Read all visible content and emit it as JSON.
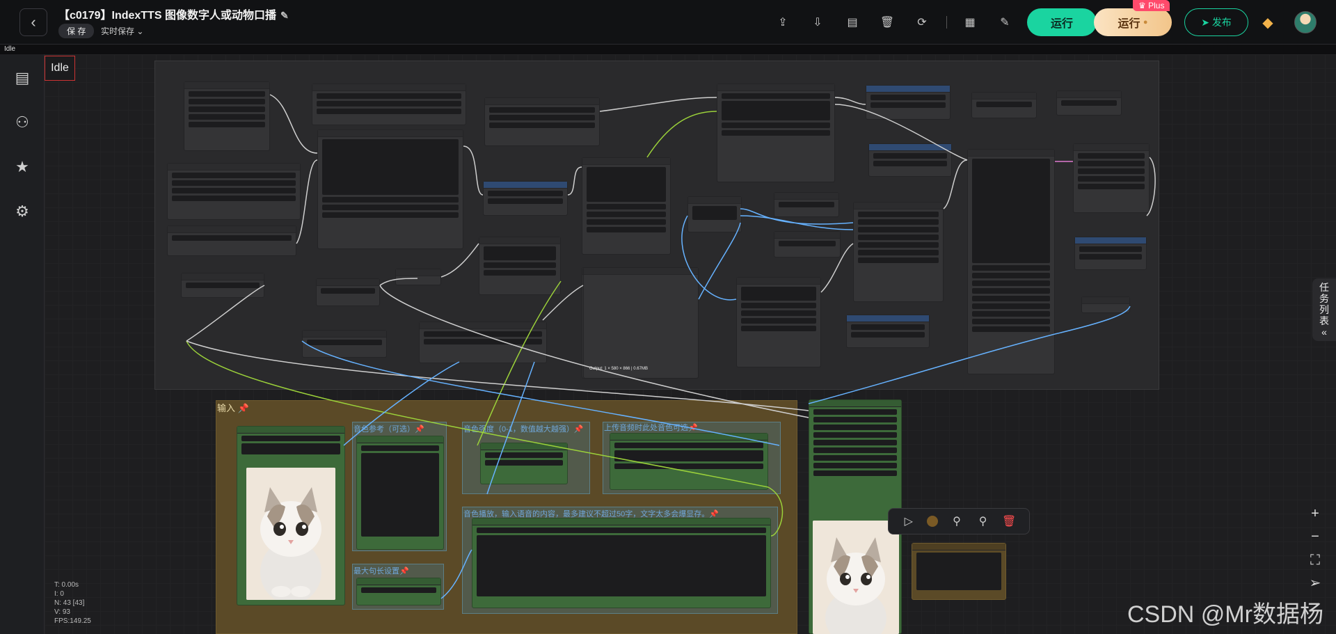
{
  "app": {
    "title": "【c0179】IndexTTS 图像数字人或动物口播",
    "save_label": "保 存",
    "autosave_label": "实时保存",
    "status_strip": "Idle",
    "status_box": "Idle"
  },
  "toolbar": {
    "icons": [
      "upload-icon",
      "download-icon",
      "translate-icon",
      "trash-icon",
      "refresh-icon",
      "grid-icon",
      "edit-icon"
    ],
    "run_label": "运行",
    "run_plus_label": "运行",
    "plus_badge": "Plus",
    "publish_label": "发布"
  },
  "sidebar": {
    "items": [
      "document-icon",
      "workflow-icon",
      "star-icon",
      "settings-icon"
    ]
  },
  "canvas": {
    "input_group_title": "输入",
    "subgroups": [
      "音色参考（可选）",
      "音色强度（0-1，数值越大越强）",
      "上传音频时此处音色可选",
      "音色播放，输入语音的内容，最多建议不超过50字，文字太多会爆显存。",
      "最大句长设置"
    ],
    "preview_output": "Output: 1 × 580 × 866 | 0.67MB"
  },
  "task_tab": {
    "label_chars": [
      "任",
      "务",
      "列",
      "表"
    ],
    "collapse_icon": "«"
  },
  "stats": {
    "t": "T: 0.00s",
    "i": "I: 0",
    "n": "N: 43 [43]",
    "v": "V: 93",
    "fps": "FPS:149.25"
  },
  "watermark": "CSDN @Mr数据杨",
  "colors": {
    "run": "#1ad4a0",
    "publish": "#1ad4a0",
    "plus_badge": "#ff4a6b",
    "group_input": "#5b4a27"
  }
}
